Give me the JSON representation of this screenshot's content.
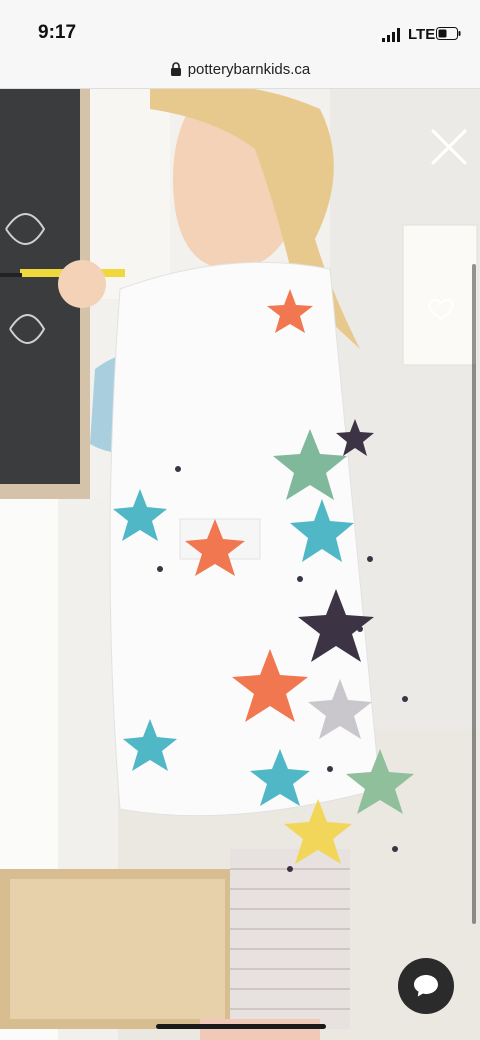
{
  "status_bar": {
    "time": "9:17",
    "network": "LTE"
  },
  "browser": {
    "url": "potterybarnkids.ca"
  },
  "viewer": {
    "icons": [
      "close-icon",
      "heart-icon",
      "chat-bubble-icon"
    ]
  },
  "colors": {
    "accent_chat": "#2b2b2b",
    "overlay_icon": "#ffffff"
  }
}
